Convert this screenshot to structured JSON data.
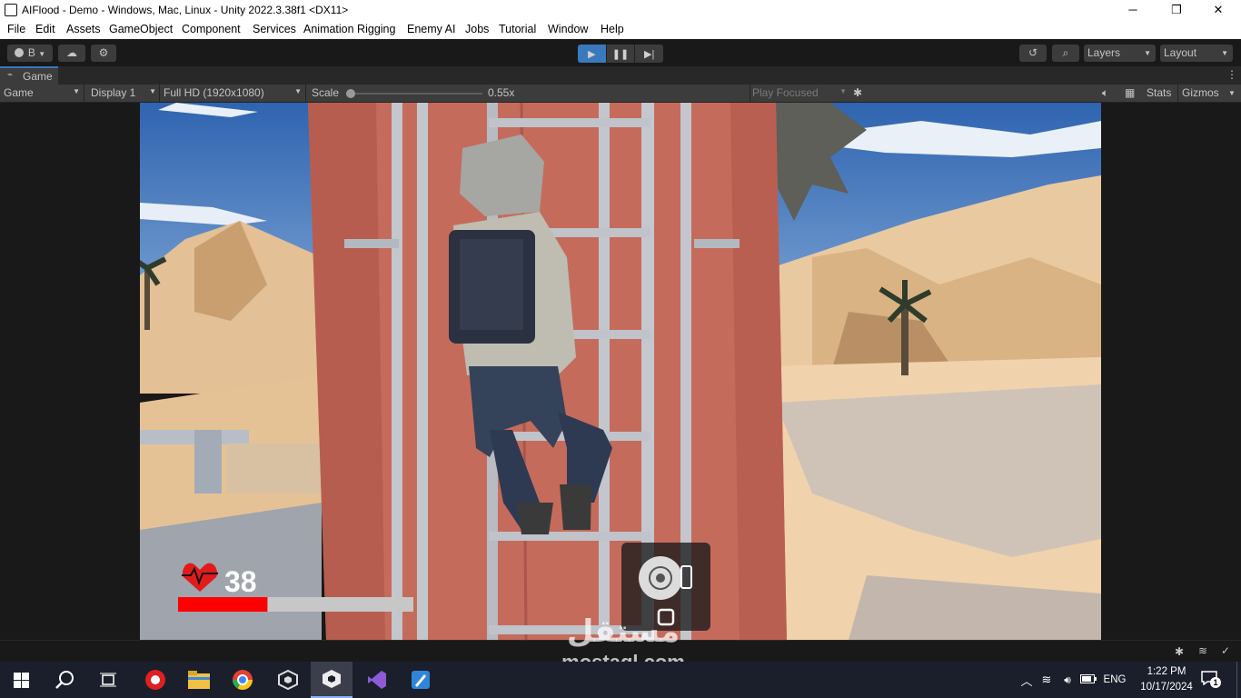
{
  "window": {
    "title": "AIFlood - Demo - Windows, Mac, Linux - Unity 2022.3.38f1 <DX11>",
    "minimize": "─",
    "maximize": "❐",
    "close": "✕"
  },
  "menu": [
    "File",
    "Edit",
    "Assets",
    "GameObject",
    "Component",
    "Services",
    "Animation Rigging",
    "Enemy AI",
    "Jobs",
    "Tutorial",
    "Window",
    "Help"
  ],
  "toolbar": {
    "account_label": "B",
    "layers_label": "Layers",
    "layout_label": "Layout"
  },
  "game_tab": {
    "label": "Game"
  },
  "game_controls": {
    "mode": "Game",
    "display": "Display 1",
    "resolution": "Full HD (1920x1080)",
    "scale_label": "Scale",
    "scale_value": "0.55x",
    "scale_fraction": 0.0,
    "play_focused": "Play Focused",
    "stats": "Stats",
    "gizmos": "Gizmos"
  },
  "hud": {
    "health_value": "38",
    "health_fraction": 0.38,
    "health_color": "#ff0000"
  },
  "watermark": {
    "arabic": "مستقل",
    "site": "mostaql.com"
  },
  "taskbar": {
    "language": "ENG",
    "time": "1:22 PM",
    "date": "10/17/2024",
    "notification_count": "1"
  },
  "colors": {
    "editor_dark": "#191919",
    "panel": "#3c3c3c",
    "play_active": "#3a79bb",
    "container": "#c56b5c",
    "sky": "#4c7ec0",
    "sand": "#e9c9a0"
  }
}
